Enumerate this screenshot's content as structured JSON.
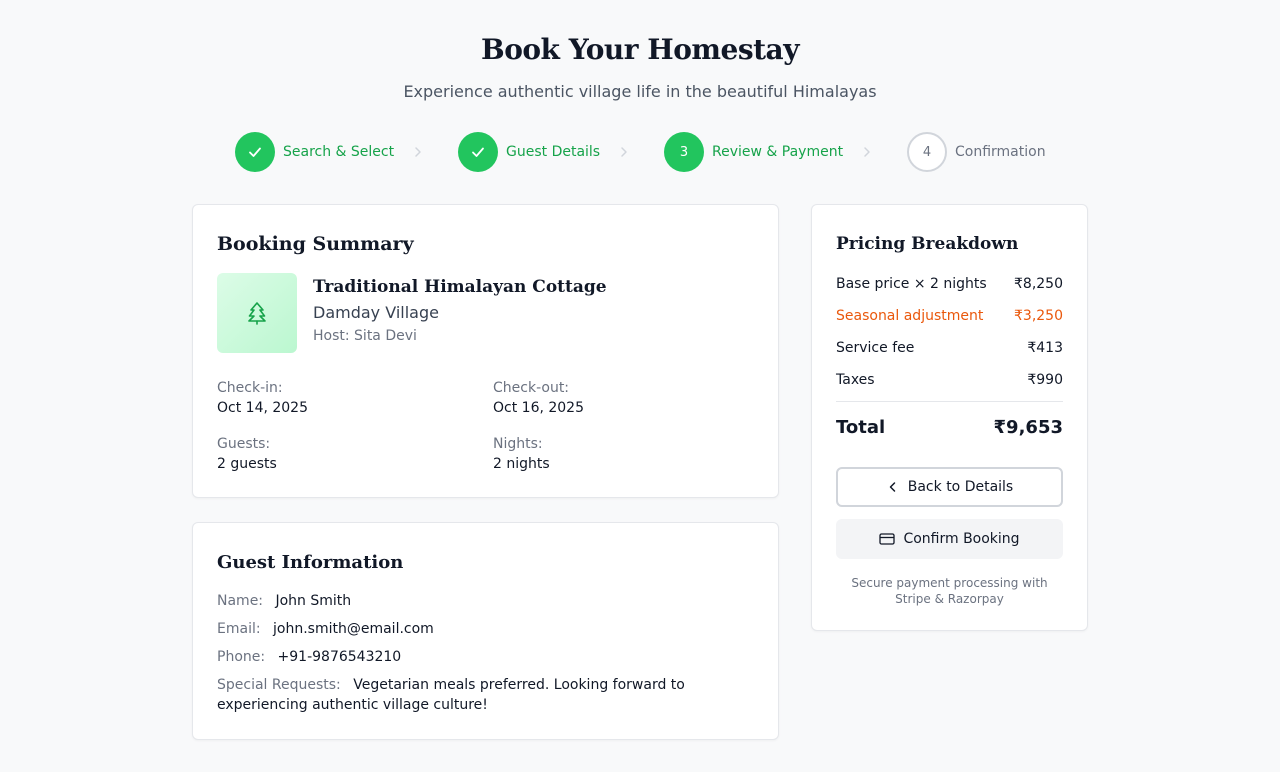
{
  "header": {
    "title": "Book Your Homestay",
    "subtitle": "Experience authentic village life in the beautiful Himalayas"
  },
  "steps": [
    {
      "label": "Search & Select",
      "state": "done",
      "number": "1"
    },
    {
      "label": "Guest Details",
      "state": "done",
      "number": "2"
    },
    {
      "label": "Review & Payment",
      "state": "active",
      "number": "3"
    },
    {
      "label": "Confirmation",
      "state": "pending",
      "number": "4"
    }
  ],
  "summary": {
    "title": "Booking Summary",
    "property_icon": "tree-icon",
    "property_name": "Traditional Himalayan Cottage",
    "village": "Damday Village",
    "host": "Host: Sita Devi",
    "checkin_label": "Check-in:",
    "checkin_value": "Oct 14, 2025",
    "checkout_label": "Check-out:",
    "checkout_value": "Oct 16, 2025",
    "guests_label": "Guests:",
    "guests_value": "2 guests",
    "nights_label": "Nights:",
    "nights_value": "2 nights"
  },
  "guest_info": {
    "title": "Guest Information",
    "name_label": "Name:",
    "name_value": "John Smith",
    "email_label": "Email:",
    "email_value": "john.smith@email.com",
    "phone_label": "Phone:",
    "phone_value": "+91-9876543210",
    "requests_label": "Special Requests:",
    "requests_value": "Vegetarian meals preferred. Looking forward to experiencing authentic village culture!"
  },
  "pricing": {
    "title": "Pricing Breakdown",
    "rows": [
      {
        "label": "Base price × 2 nights",
        "value": "₹8,250"
      },
      {
        "label": "Seasonal adjustment",
        "value": "₹3,250"
      },
      {
        "label": "Service fee",
        "value": "₹413"
      },
      {
        "label": "Taxes",
        "value": "₹990"
      }
    ],
    "total_label": "Total",
    "total_value": "₹9,653",
    "back_label": "Back to Details",
    "confirm_label": "Confirm Booking",
    "secure_note": "Secure payment processing with Stripe & Razorpay"
  },
  "colors": {
    "accent_green": "#22c55e",
    "step_text_green": "#16a34a",
    "adjustment_orange": "#ea580c"
  }
}
